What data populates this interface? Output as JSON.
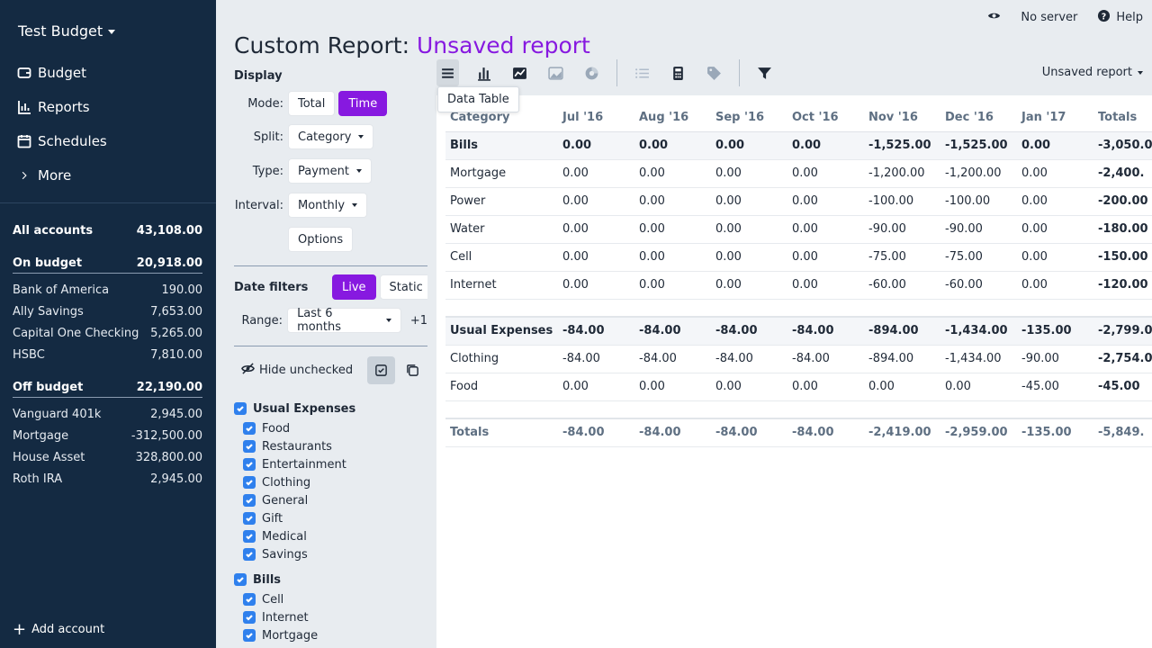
{
  "sidebar": {
    "budget_name": "Test Budget",
    "nav": [
      {
        "label": "Budget",
        "icon": "wallet-icon"
      },
      {
        "label": "Reports",
        "icon": "reports-icon"
      },
      {
        "label": "Schedules",
        "icon": "calendar-icon"
      },
      {
        "label": "More",
        "icon": "chevron-right-icon"
      }
    ],
    "all_accounts": {
      "label": "All accounts",
      "amount": "43,108.00"
    },
    "on_budget": {
      "label": "On budget",
      "amount": "20,918.00",
      "accounts": [
        {
          "name": "Bank of America",
          "amount": "190.00"
        },
        {
          "name": "Ally Savings",
          "amount": "7,653.00"
        },
        {
          "name": "Capital One Checking",
          "amount": "5,265.00"
        },
        {
          "name": "HSBC",
          "amount": "7,810.00"
        }
      ]
    },
    "off_budget": {
      "label": "Off budget",
      "amount": "22,190.00",
      "accounts": [
        {
          "name": "Vanguard 401k",
          "amount": "2,945.00"
        },
        {
          "name": "Mortgage",
          "amount": "-312,500.00"
        },
        {
          "name": "House Asset",
          "amount": "328,800.00"
        },
        {
          "name": "Roth IRA",
          "amount": "2,945.00"
        }
      ]
    },
    "add_account": "Add account"
  },
  "topbar": {
    "server": "No server",
    "help": "Help"
  },
  "title": {
    "prefix": "Custom Report:",
    "name": "Unsaved report"
  },
  "panel": {
    "display_heading": "Display",
    "mode_label": "Mode:",
    "mode_total": "Total",
    "mode_time": "Time",
    "split_label": "Split:",
    "split_value": "Category",
    "type_label": "Type:",
    "type_value": "Payment",
    "interval_label": "Interval:",
    "interval_value": "Monthly",
    "options": "Options",
    "date_filters": "Date filters",
    "live": "Live",
    "static": "Static",
    "range_label": "Range:",
    "range_value": "Last 6 months",
    "range_extra": "+1",
    "hide_unchecked": "Hide unchecked"
  },
  "categories": {
    "usual": {
      "label": "Usual Expenses",
      "items": [
        "Food",
        "Restaurants",
        "Entertainment",
        "Clothing",
        "General",
        "Gift",
        "Medical",
        "Savings"
      ]
    },
    "bills": {
      "label": "Bills",
      "items": [
        "Cell",
        "Internet",
        "Mortgage"
      ]
    }
  },
  "toolbar": {
    "tooltip": "Data Table",
    "saved_menu": "Unsaved report"
  },
  "table": {
    "headers": [
      "Category",
      "Jul '16",
      "Aug '16",
      "Sep '16",
      "Oct '16",
      "Nov '16",
      "Dec '16",
      "Jan '17",
      "Totals"
    ],
    "groups": [
      {
        "name": "Bills",
        "values": [
          "0.00",
          "0.00",
          "0.00",
          "0.00",
          "-1,525.00",
          "-1,525.00",
          "0.00",
          "-3,050.0"
        ],
        "rows": [
          {
            "name": "Mortgage",
            "values": [
              "0.00",
              "0.00",
              "0.00",
              "0.00",
              "-1,200.00",
              "-1,200.00",
              "0.00",
              "-2,400."
            ]
          },
          {
            "name": "Power",
            "values": [
              "0.00",
              "0.00",
              "0.00",
              "0.00",
              "-100.00",
              "-100.00",
              "0.00",
              "-200.00"
            ]
          },
          {
            "name": "Water",
            "values": [
              "0.00",
              "0.00",
              "0.00",
              "0.00",
              "-90.00",
              "-90.00",
              "0.00",
              "-180.00"
            ]
          },
          {
            "name": "Cell",
            "values": [
              "0.00",
              "0.00",
              "0.00",
              "0.00",
              "-75.00",
              "-75.00",
              "0.00",
              "-150.00"
            ]
          },
          {
            "name": "Internet",
            "values": [
              "0.00",
              "0.00",
              "0.00",
              "0.00",
              "-60.00",
              "-60.00",
              "0.00",
              "-120.00"
            ]
          }
        ]
      },
      {
        "name": "Usual Expenses",
        "values": [
          "-84.00",
          "-84.00",
          "-84.00",
          "-84.00",
          "-894.00",
          "-1,434.00",
          "-135.00",
          "-2,799.0"
        ],
        "rows": [
          {
            "name": "Clothing",
            "values": [
              "-84.00",
              "-84.00",
              "-84.00",
              "-84.00",
              "-894.00",
              "-1,434.00",
              "-90.00",
              "-2,754.0"
            ]
          },
          {
            "name": "Food",
            "values": [
              "0.00",
              "0.00",
              "0.00",
              "0.00",
              "0.00",
              "0.00",
              "-45.00",
              "-45.00"
            ]
          }
        ]
      }
    ],
    "totals": {
      "name": "Totals",
      "values": [
        "-84.00",
        "-84.00",
        "-84.00",
        "-84.00",
        "-2,419.00",
        "-2,959.00",
        "-135.00",
        "-5,849."
      ]
    }
  },
  "colors": {
    "accent": "#8719e0",
    "sidebar_bg": "#142a42",
    "checkbox": "#2f80ed"
  }
}
